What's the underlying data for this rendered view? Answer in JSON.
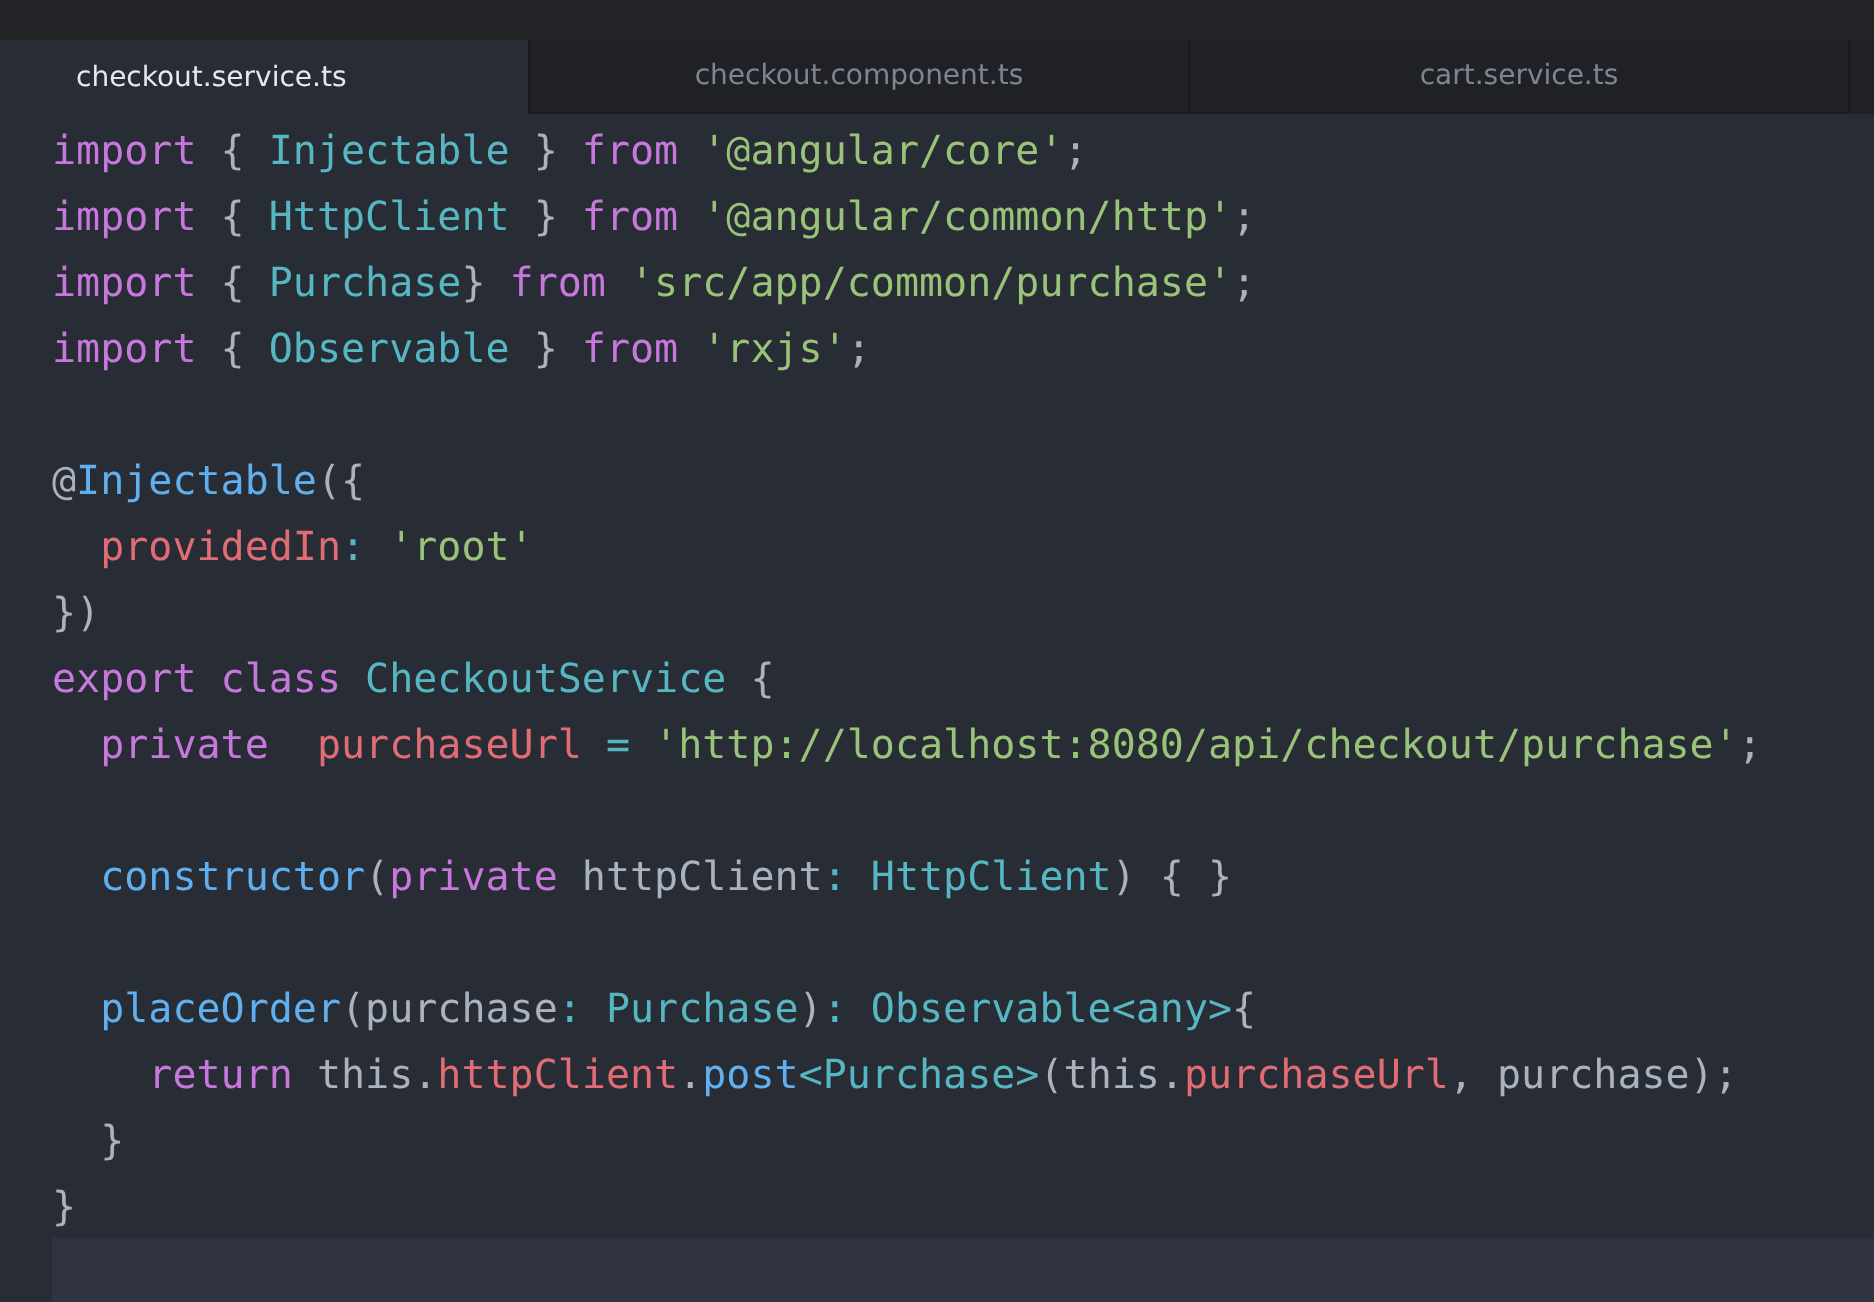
{
  "tabs": [
    {
      "label": "checkout.service.ts",
      "selected": true
    },
    {
      "label": "checkout.component.ts",
      "selected": false
    },
    {
      "label": "cart.service.ts",
      "selected": false
    }
  ],
  "lines": [
    {
      "current": false,
      "tokens": [
        {
          "kind": "keyword",
          "text": "import"
        },
        {
          "kind": "plain",
          "text": " { "
        },
        {
          "kind": "type",
          "text": "Injectable"
        },
        {
          "kind": "plain",
          "text": " } "
        },
        {
          "kind": "keyword",
          "text": "from"
        },
        {
          "kind": "string",
          "text": " '@angular/core'"
        },
        {
          "kind": "plain",
          "text": ";"
        }
      ]
    },
    {
      "current": false,
      "tokens": [
        {
          "kind": "keyword",
          "text": "import"
        },
        {
          "kind": "plain",
          "text": " { "
        },
        {
          "kind": "type",
          "text": "HttpClient"
        },
        {
          "kind": "plain",
          "text": " } "
        },
        {
          "kind": "keyword",
          "text": "from"
        },
        {
          "kind": "string",
          "text": " '@angular/common/http'"
        },
        {
          "kind": "plain",
          "text": ";"
        }
      ]
    },
    {
      "current": false,
      "tokens": [
        {
          "kind": "keyword",
          "text": "import"
        },
        {
          "kind": "plain",
          "text": " { "
        },
        {
          "kind": "type",
          "text": "Purchase"
        },
        {
          "kind": "plain",
          "text": "} "
        },
        {
          "kind": "keyword",
          "text": "from"
        },
        {
          "kind": "string",
          "text": " 'src/app/common/purchase'"
        },
        {
          "kind": "plain",
          "text": ";"
        }
      ]
    },
    {
      "current": false,
      "tokens": [
        {
          "kind": "keyword",
          "text": "import"
        },
        {
          "kind": "plain",
          "text": " { "
        },
        {
          "kind": "type",
          "text": "Observable"
        },
        {
          "kind": "plain",
          "text": " } "
        },
        {
          "kind": "keyword",
          "text": "from"
        },
        {
          "kind": "string",
          "text": " 'rxjs'"
        },
        {
          "kind": "plain",
          "text": ";"
        }
      ]
    },
    {
      "current": false
    },
    {
      "current": false,
      "tokens": [
        {
          "kind": "plain",
          "text": "@"
        },
        {
          "kind": "function",
          "text": "Injectable"
        },
        {
          "kind": "plain",
          "text": "({"
        }
      ]
    },
    {
      "current": false,
      "tokens": [
        {
          "kind": "property",
          "text": "  providedIn"
        },
        {
          "kind": "type",
          "text": ": "
        },
        {
          "kind": "string",
          "text": "'root'"
        }
      ]
    },
    {
      "current": false,
      "tokens": [
        {
          "kind": "plain",
          "text": "})"
        }
      ]
    },
    {
      "current": false,
      "tokens": [
        {
          "kind": "keyword",
          "text": "export class "
        },
        {
          "kind": "type",
          "text": "CheckoutService"
        },
        {
          "kind": "plain",
          "text": " {"
        }
      ]
    },
    {
      "current": false,
      "tokens": [
        {
          "kind": "keyword",
          "text": "  private  "
        },
        {
          "kind": "property",
          "text": "purchaseUrl "
        },
        {
          "kind": "type",
          "text": "= "
        },
        {
          "kind": "string",
          "text": "'http://localhost:8080/api/checkout/purchase'"
        },
        {
          "kind": "plain",
          "text": ";"
        }
      ]
    },
    {
      "current": false
    },
    {
      "current": false,
      "tokens": [
        {
          "kind": "function",
          "text": "  constructor"
        },
        {
          "kind": "plain",
          "text": "("
        },
        {
          "kind": "keyword",
          "text": "private"
        },
        {
          "kind": "plain",
          "text": " httpClient"
        },
        {
          "kind": "type",
          "text": ": HttpClient"
        },
        {
          "kind": "plain",
          "text": ") { }"
        }
      ]
    },
    {
      "current": false
    },
    {
      "current": false,
      "tokens": [
        {
          "kind": "function",
          "text": "  placeOrder"
        },
        {
          "kind": "plain",
          "text": "(purchase"
        },
        {
          "kind": "type",
          "text": ": Purchase"
        },
        {
          "kind": "plain",
          "text": ")"
        },
        {
          "kind": "type",
          "text": ": Observable<any>"
        },
        {
          "kind": "plain",
          "text": "{"
        }
      ]
    },
    {
      "current": false,
      "tokens": [
        {
          "kind": "keyword",
          "text": "    return"
        },
        {
          "kind": "plain",
          "text": " this."
        },
        {
          "kind": "property",
          "text": "httpClient"
        },
        {
          "kind": "plain",
          "text": "."
        },
        {
          "kind": "function",
          "text": "post"
        },
        {
          "kind": "type",
          "text": "<Purchase>"
        },
        {
          "kind": "plain",
          "text": "(this."
        },
        {
          "kind": "property",
          "text": "purchaseUrl"
        },
        {
          "kind": "plain",
          "text": ", purchase);"
        }
      ]
    },
    {
      "current": false,
      "tokens": [
        {
          "kind": "plain",
          "text": "  }"
        }
      ]
    },
    {
      "current": false,
      "tokens": [
        {
          "kind": "plain",
          "text": "}"
        }
      ]
    },
    {
      "current": true
    }
  ]
}
